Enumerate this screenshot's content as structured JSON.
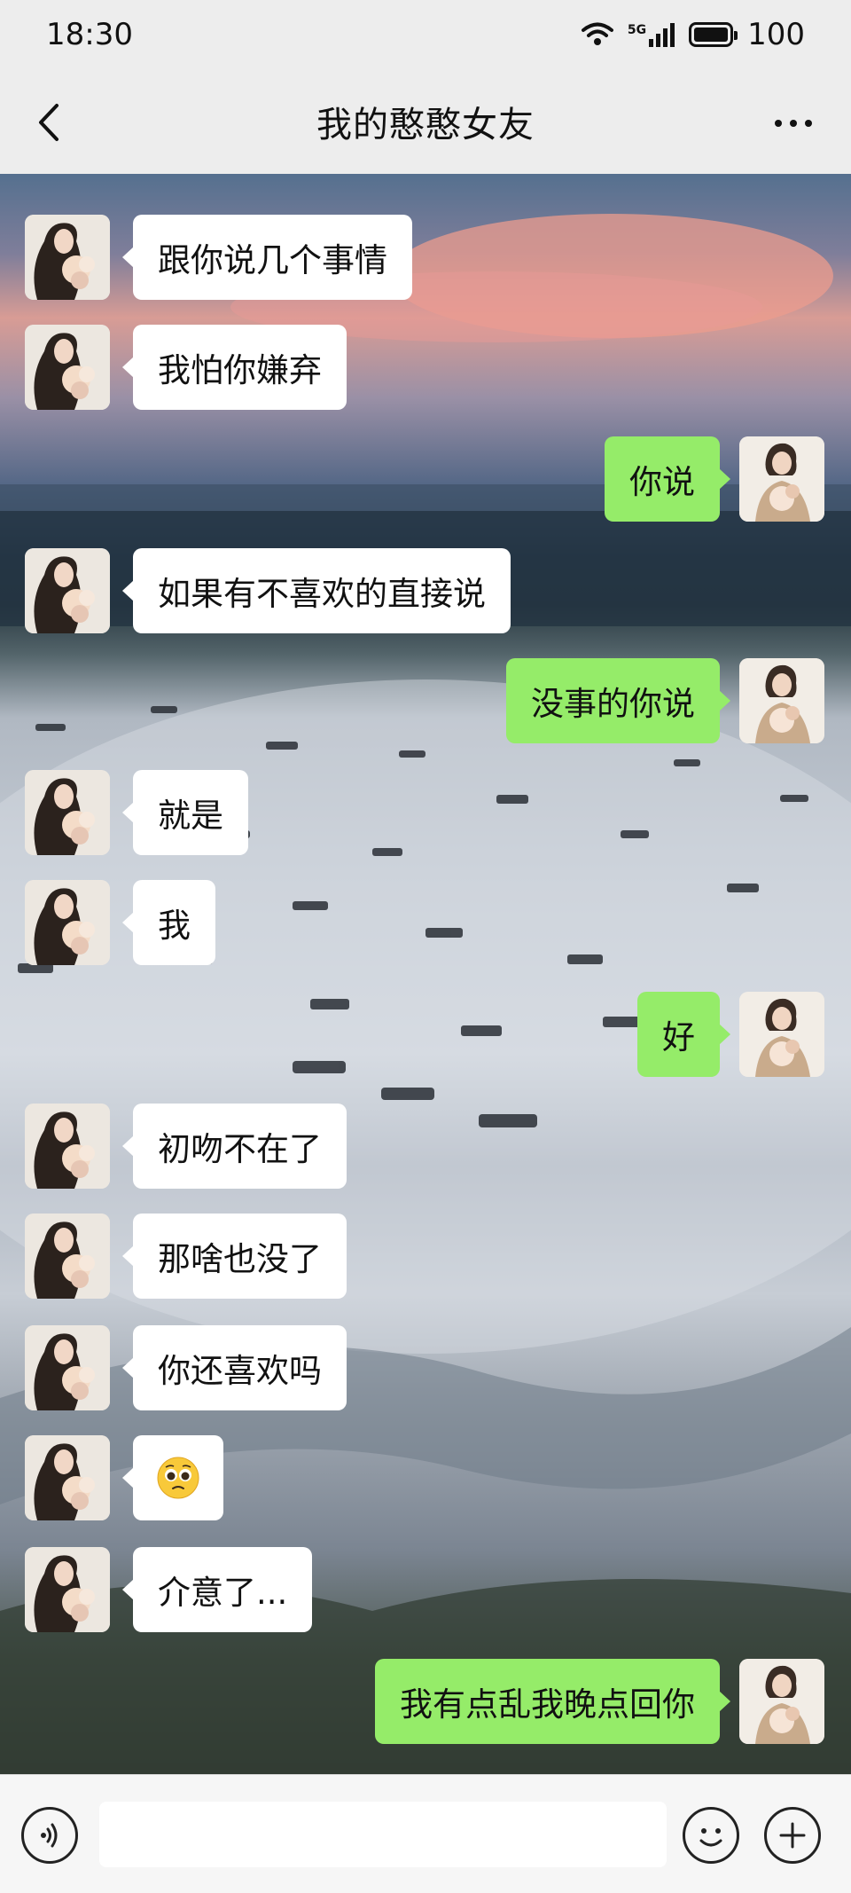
{
  "status_bar": {
    "time": "18:30",
    "network": "5G",
    "battery_level": "100"
  },
  "nav": {
    "title": "我的憨憨女友"
  },
  "messages": [
    {
      "side": "left",
      "text": "跟你说几个事情"
    },
    {
      "side": "left",
      "text": "我怕你嫌弃"
    },
    {
      "side": "right",
      "text": "你说"
    },
    {
      "side": "left",
      "text": "如果有不喜欢的直接说"
    },
    {
      "side": "right",
      "text": "没事的你说"
    },
    {
      "side": "left",
      "text": "就是"
    },
    {
      "side": "left",
      "text": "我"
    },
    {
      "side": "right",
      "text": "好"
    },
    {
      "side": "left",
      "text": "初吻不在了"
    },
    {
      "side": "left",
      "text": "那啥也没了"
    },
    {
      "side": "left",
      "text": "你还喜欢吗"
    },
    {
      "side": "left",
      "emoji": "pleading-face-icon"
    },
    {
      "side": "left",
      "text": "介意了..."
    },
    {
      "side": "right",
      "text": "我有点乱我晚点回你"
    }
  ],
  "colors": {
    "bubble_sent": "#95ec69",
    "bubble_received": "#ffffff",
    "bar_bg": "#ededed"
  }
}
